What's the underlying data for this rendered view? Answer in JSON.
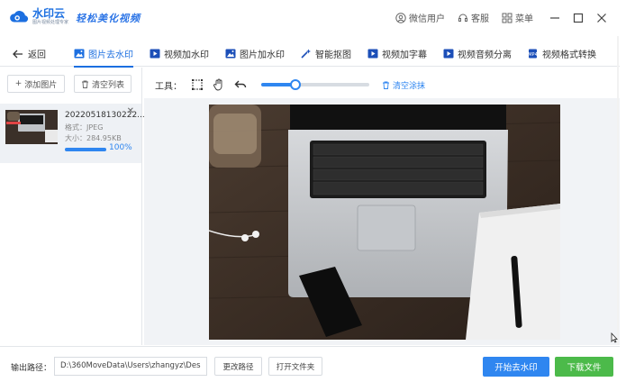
{
  "app": {
    "name": "水印云",
    "sub": "图片视频处理专家",
    "slogan": "轻松美化视频",
    "brand_color": "#1c6fe0"
  },
  "titlebar": {
    "user_label": "微信用户",
    "service_label": "客服",
    "menu_label": "菜单"
  },
  "nav": {
    "back_label": "返回",
    "tabs": [
      {
        "label": "图片去水印",
        "icon": "image-icon",
        "active": true
      },
      {
        "label": "视频加水印",
        "icon": "video-icon",
        "active": false
      },
      {
        "label": "图片加水印",
        "icon": "image-icon",
        "active": false
      },
      {
        "label": "智能抠图",
        "icon": "magic-wand-icon",
        "active": false
      },
      {
        "label": "视频加字幕",
        "icon": "video-icon",
        "active": false
      },
      {
        "label": "视频音频分离",
        "icon": "video-icon",
        "active": false
      },
      {
        "label": "视频格式转换",
        "icon": "file-convert-icon",
        "active": false
      }
    ]
  },
  "leftpanel": {
    "add_label": "添加图片",
    "clear_label": "清空列表",
    "file": {
      "name": "20220518130222...",
      "format": "格式：JPEG",
      "size": "大小：284.95KB",
      "progress": 1.0,
      "progress_label": "100%"
    }
  },
  "tools": {
    "label": "工具：",
    "slider_value": 0.32,
    "clear_label": "清空涂抹"
  },
  "bottom": {
    "output_label": "输出路径：",
    "output_path": "D:\\360MoveData\\Users\\zhangyz\\Des",
    "change_path_label": "更改路径",
    "open_folder_label": "打开文件夹",
    "start_label": "开始去水印",
    "download_label": "下载文件",
    "start_color": "#2f86f0",
    "download_color": "#4cba4a"
  }
}
